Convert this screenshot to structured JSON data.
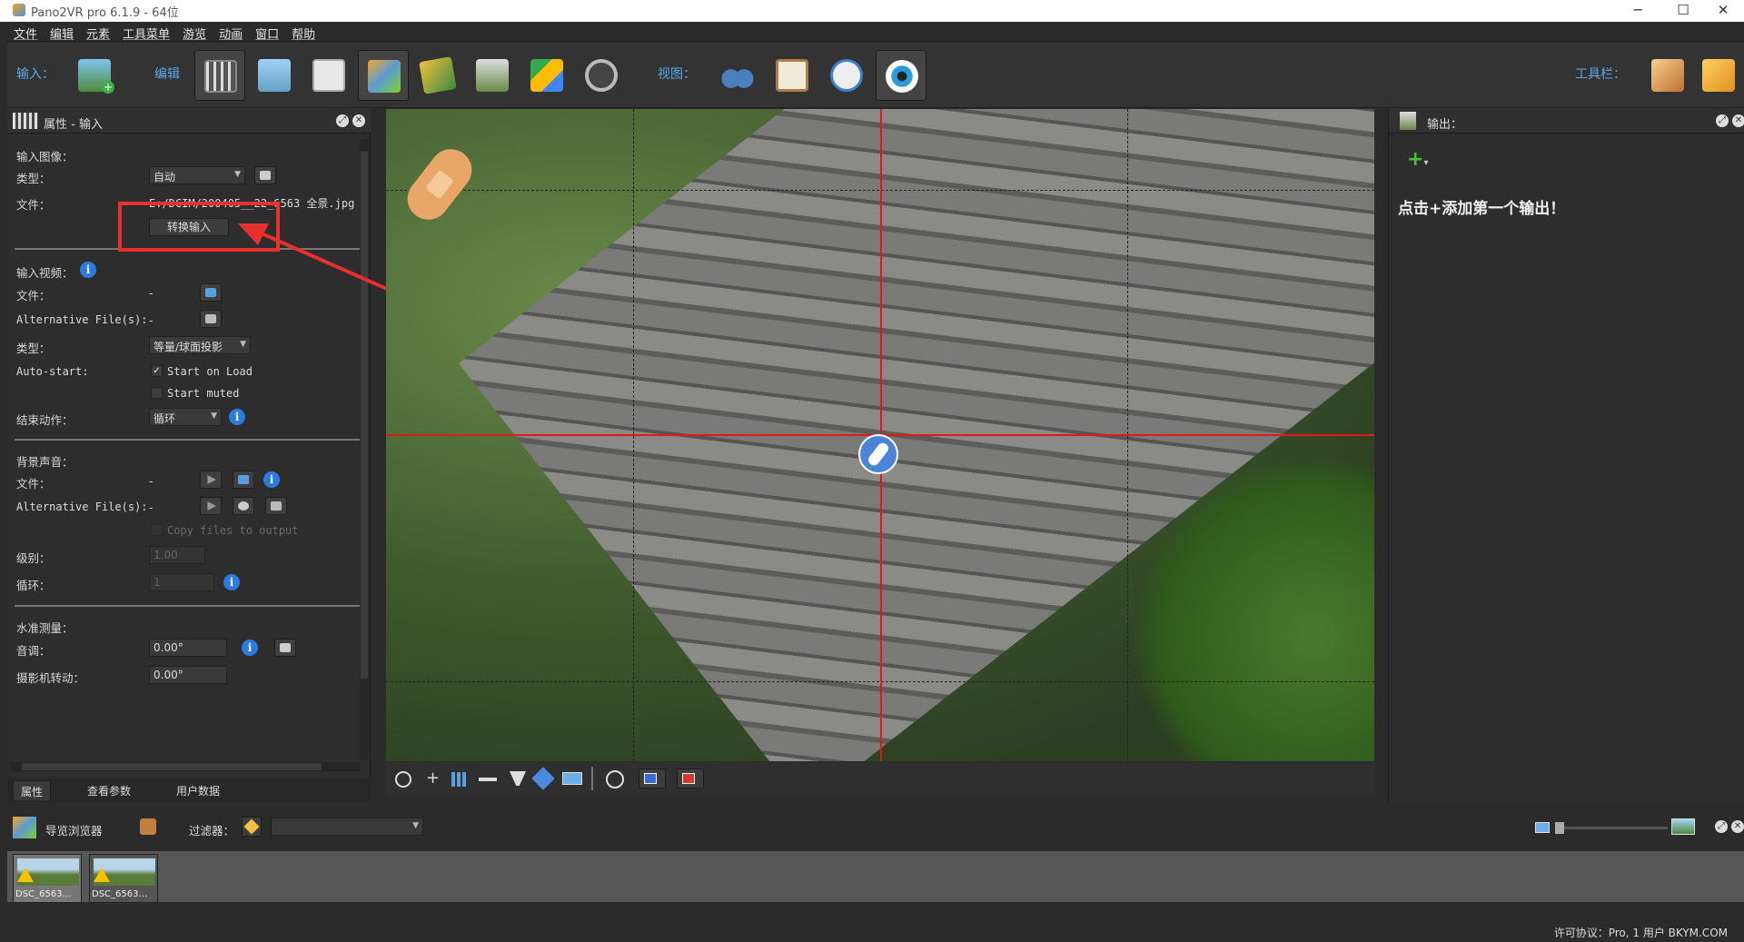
{
  "window": {
    "title": "Pano2VR pro 6.1.9 - 64位",
    "minimize": "─",
    "maximize": "☐",
    "close": "✕"
  },
  "menu": [
    "文件",
    "编辑",
    "元素",
    "工具菜单",
    "游览",
    "动画",
    "窗口",
    "帮助"
  ],
  "toolbar": {
    "input_label": "输入：",
    "edit_label": "编辑",
    "view_label": "视图：",
    "toolbar_label": "工具栏："
  },
  "left_panel": {
    "title": "属性 - 输入",
    "input_image": {
      "section": "输入图像：",
      "type_label": "类型：",
      "type_value": "自动",
      "file_label": "文件：",
      "file_value": "E:/DCIM/200405__22_6563 全景.jpg",
      "convert_button": "转换输入"
    },
    "input_video": {
      "section": "输入视频：",
      "file_label": "文件：",
      "file_value": "-",
      "alt_label": "Alternative File(s):",
      "alt_value": "-",
      "type_label": "类型：",
      "type_value": "等量/球面投影",
      "autostart_label": "Auto-start:",
      "start_on_load": "Start on Load",
      "start_muted": "Start muted",
      "end_action_label": "结束动作：",
      "end_action_value": "循环"
    },
    "bg_sound": {
      "section": "背景声音：",
      "file_label": "文件：",
      "file_value": "-",
      "alt_label": "Alternative File(s):",
      "alt_value": "-",
      "copy_files": "Copy files to output",
      "level_label": "级别：",
      "level_value": "1.00",
      "loop_label": "循环：",
      "loop_value": "1"
    },
    "level": {
      "section": "水准测量：",
      "pitch_label": "音调：",
      "pitch_value": "0.00°",
      "roll_label": "摄影机转动：",
      "roll_value": "0.00°"
    }
  },
  "tabs": [
    "属性",
    "查看参数",
    "用户数据"
  ],
  "right_panel": {
    "title": "输出：",
    "hint": "点击+添加第一个输出！"
  },
  "browser": {
    "title": "导览浏览器",
    "filter_label": "过滤器：",
    "items": [
      {
        "label": "DSC_6563…"
      },
      {
        "label": "DSC_6563…"
      }
    ]
  },
  "status": "许可协议：Pro, 1 用户 BKYM.COM",
  "colors": {
    "accent_blue": "#5aa9e6",
    "annotation_red": "#e83030",
    "crosshair": "#e01818"
  }
}
